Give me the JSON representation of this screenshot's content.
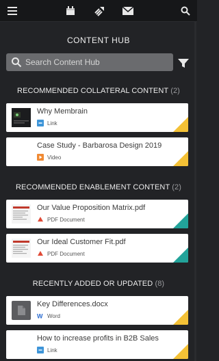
{
  "topbar": {
    "icons": [
      "menu-icon",
      "calendar-icon",
      "rocket-icon",
      "mail-icon",
      "search-icon"
    ]
  },
  "header": {
    "title": "CONTENT HUB"
  },
  "search": {
    "placeholder": "Search Content Hub"
  },
  "colors": {
    "background": "#222326",
    "topbar": "#161719",
    "card": "#ffffff",
    "yellow_corner": "#f4c136",
    "teal_corner": "#22a39a",
    "link_icon": "#3e95d8",
    "video_icon": "#f08a34",
    "pdf_icon": "#e04a36",
    "word_icon": "#2b6cd0"
  },
  "sections": [
    {
      "title": "RECOMMENDED COLLATERAL CONTENT",
      "count": "(2)",
      "items": [
        {
          "title": "Why Membrain",
          "type": "Link",
          "type_icon": "link-icon",
          "thumb": "video-thumbnail",
          "corner": "yellow"
        },
        {
          "title": "Case Study - Barbarosa Design 2019",
          "type": "Video",
          "type_icon": "play-icon",
          "thumb": "none",
          "corner": "yellow"
        }
      ]
    },
    {
      "title": "RECOMMENDED ENABLEMENT CONTENT",
      "count": "(2)",
      "items": [
        {
          "title": "Our Value Proposition Matrix.pdf",
          "type": "PDF Document",
          "type_icon": "pdf-icon",
          "thumb": "document-thumbnail",
          "corner": "teal"
        },
        {
          "title": "Our Ideal Customer Fit.pdf",
          "type": "PDF Document",
          "type_icon": "pdf-icon",
          "thumb": "document-thumbnail",
          "corner": "teal"
        }
      ]
    },
    {
      "title": "RECENTLY ADDED OR UPDATED",
      "count": "(8)",
      "items": [
        {
          "title": "Key Differences.docx",
          "type": "Word",
          "type_icon": "word-icon",
          "thumb": "file-thumbnail",
          "corner": "yellow"
        },
        {
          "title": "How to increase profits in B2B Sales",
          "type": "Link",
          "type_icon": "link-icon",
          "thumb": "none",
          "corner": "yellow"
        }
      ]
    }
  ]
}
